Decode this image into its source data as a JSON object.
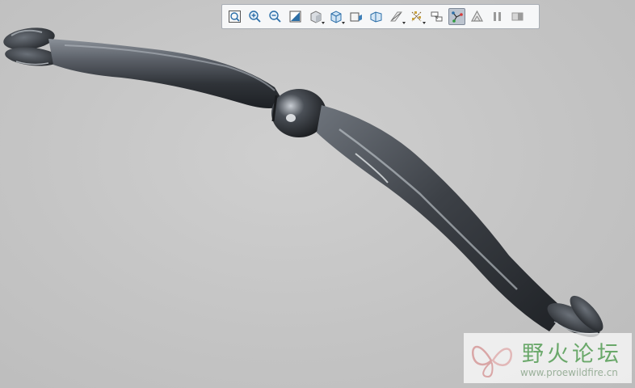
{
  "toolbar": {
    "buttons": [
      {
        "icon": "refit-icon",
        "active": false,
        "dropdown": false
      },
      {
        "icon": "zoom-in-icon",
        "active": false,
        "dropdown": false
      },
      {
        "icon": "zoom-out-icon",
        "active": false,
        "dropdown": false
      },
      {
        "icon": "repaint-icon",
        "active": false,
        "dropdown": false
      },
      {
        "icon": "display-style-icon",
        "active": false,
        "dropdown": true
      },
      {
        "icon": "saved-orientations-icon",
        "active": false,
        "dropdown": true
      },
      {
        "icon": "view-manager-icon",
        "active": false,
        "dropdown": false
      },
      {
        "icon": "perspective-view-icon",
        "active": false,
        "dropdown": false
      },
      {
        "icon": "section-icon",
        "active": false,
        "dropdown": true
      },
      {
        "icon": "datum-display-icon",
        "active": false,
        "dropdown": true
      },
      {
        "icon": "annotation-display-icon",
        "active": false,
        "dropdown": false
      },
      {
        "icon": "spin-center-icon",
        "active": true,
        "dropdown": false
      },
      {
        "icon": "mesh-triangles-icon",
        "active": false,
        "dropdown": false
      },
      {
        "icon": "pause-icon",
        "active": false,
        "dropdown": false
      },
      {
        "icon": "appearance-icon",
        "active": false,
        "dropdown": false
      }
    ]
  },
  "watermark": {
    "title": "野火论坛",
    "url": "www.proewildfire.cn"
  },
  "colors": {
    "background": "#c6c6c6",
    "model": "#3d4147",
    "watermark_green": "#6aa86a"
  }
}
